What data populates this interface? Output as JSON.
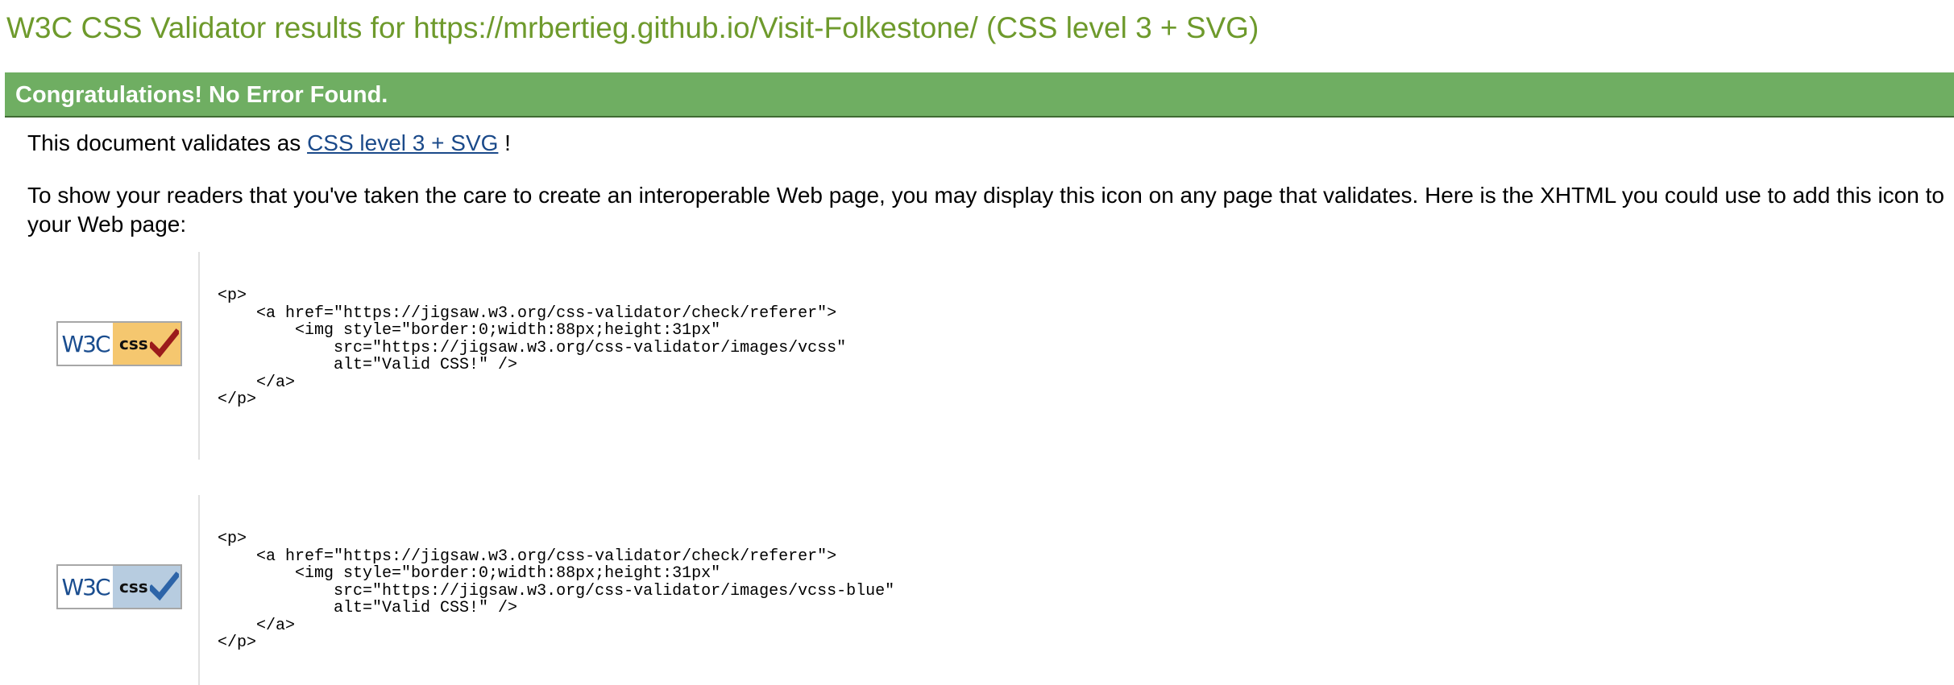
{
  "colors": {
    "title": "#6e9a2c",
    "banner_bg": "#6fae62",
    "banner_text": "#ffffff",
    "link": "#1b4a8a",
    "badge_yellow": "#f5c76f",
    "badge_blue": "#b7cce0",
    "check_red": "#9b1b1b",
    "check_blue": "#2d64a8"
  },
  "page_title": "W3C CSS Validator results for https://mrbertieg.github.io/Visit-Folkestone/ (CSS level 3 + SVG)",
  "banner": {
    "text": "Congratulations! No Error Found."
  },
  "validates": {
    "prefix": "This document validates as ",
    "link_text": "CSS level 3 + SVG",
    "suffix": " !"
  },
  "readers_text": "To show your readers that you've taken the care to create an interoperable Web page, you may display this icon on any page that validates. Here is the XHTML you could use to add this icon to your Web page:",
  "badges": [
    {
      "icon": "w3c-css-badge-gold-icon",
      "w3c_text": "W3C",
      "css_text": "css",
      "code": "<p>\n    <a href=\"https://jigsaw.w3.org/css-validator/check/referer\">\n        <img style=\"border:0;width:88px;height:31px\"\n            src=\"https://jigsaw.w3.org/css-validator/images/vcss\"\n            alt=\"Valid CSS!\" />\n    </a>\n</p>"
    },
    {
      "icon": "w3c-css-badge-blue-icon",
      "w3c_text": "W3C",
      "css_text": "css",
      "code": "<p>\n    <a href=\"https://jigsaw.w3.org/css-validator/check/referer\">\n        <img style=\"border:0;width:88px;height:31px\"\n            src=\"https://jigsaw.w3.org/css-validator/images/vcss-blue\"\n            alt=\"Valid CSS!\" />\n    </a>\n</p>"
    }
  ]
}
